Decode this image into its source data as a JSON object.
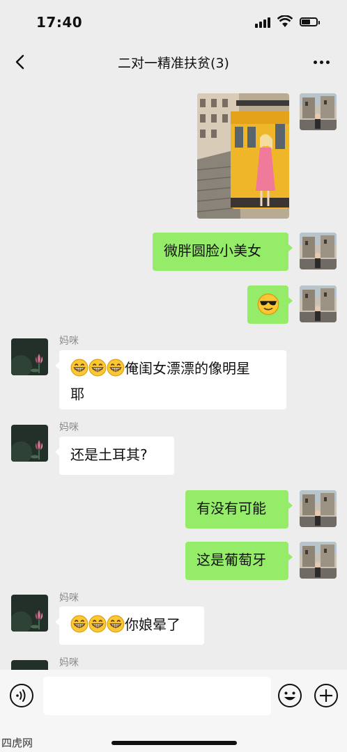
{
  "status_bar": {
    "time": "17:40"
  },
  "nav": {
    "title": "二对一精准扶贫(3)"
  },
  "messages": [
    {
      "side": "out",
      "type": "image"
    },
    {
      "side": "out",
      "type": "text",
      "text": "微胖圆脸小美女"
    },
    {
      "side": "out",
      "type": "emoji",
      "emoji": "sunglasses-emoji"
    },
    {
      "side": "in",
      "sender": "妈咪",
      "type": "text",
      "text": "俺闺女漂漂的像明星耶",
      "emoji_prefix": "grin-emoji x3"
    },
    {
      "side": "in",
      "sender": "妈咪",
      "type": "text",
      "text": "还是土耳其?"
    },
    {
      "side": "out",
      "type": "text",
      "text": "有没有可能"
    },
    {
      "side": "out",
      "type": "text",
      "text": "这是葡萄牙"
    },
    {
      "side": "in",
      "sender": "妈咪",
      "type": "text",
      "text": "你娘晕了",
      "emoji_prefix": "grin-emoji x3"
    },
    {
      "side": "in",
      "sender": "妈咪",
      "type": "partial"
    }
  ],
  "msg": {
    "m2": "微胖圆脸小美女",
    "m4_line1": "俺闺女漂漂的像明星",
    "m4_line2": "耶",
    "m5": "还是土耳其?",
    "m6": "有没有可能",
    "m7": "这是葡萄牙",
    "m8": "你娘晕了"
  },
  "senders": {
    "mom": "妈咪"
  },
  "input": {
    "placeholder": ""
  },
  "watermark": "四虎网",
  "colors": {
    "background": "#ededed",
    "outgoing_bubble": "#95ec69",
    "incoming_bubble": "#ffffff",
    "sender_name": "#8a8a8a"
  }
}
